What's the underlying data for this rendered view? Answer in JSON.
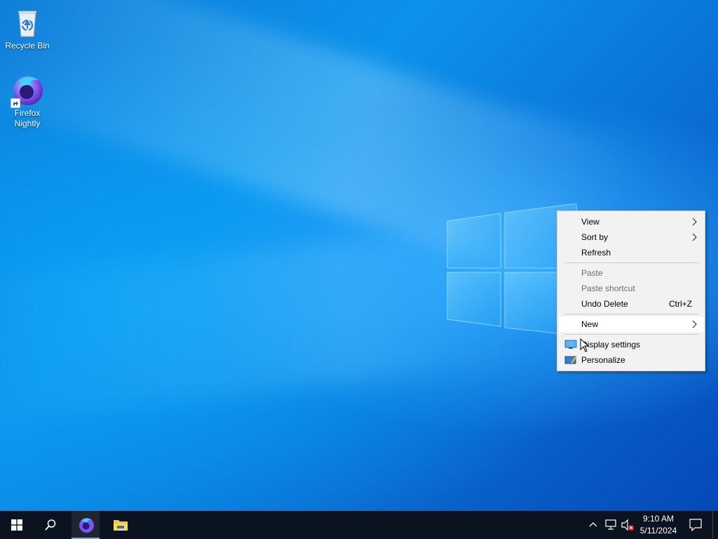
{
  "desktop": {
    "icons": [
      {
        "label": "Recycle Bin",
        "icon": "recycle-bin-icon"
      },
      {
        "label": "Firefox Nightly",
        "icon": "firefox-nightly-icon"
      }
    ]
  },
  "context_menu": {
    "items": [
      {
        "label": "View",
        "submenu": true,
        "enabled": true
      },
      {
        "label": "Sort by",
        "submenu": true,
        "enabled": true
      },
      {
        "label": "Refresh",
        "enabled": true
      },
      {
        "label": "Paste",
        "enabled": false
      },
      {
        "label": "Paste shortcut",
        "enabled": false
      },
      {
        "label": "Undo Delete",
        "shortcut": "Ctrl+Z",
        "enabled": true
      },
      {
        "label": "New",
        "submenu": true,
        "enabled": true,
        "highlighted": true
      },
      {
        "label": "Display settings",
        "icon": "display-settings-icon",
        "enabled": true
      },
      {
        "label": "Personalize",
        "icon": "personalize-icon",
        "enabled": true
      }
    ]
  },
  "taskbar": {
    "start_icon": "windows-start-icon",
    "search_icon": "search-icon",
    "pinned": [
      "firefox-nightly-icon",
      "file-explorer-icon"
    ],
    "tray_icons": [
      "chevron-up-icon",
      "network-icon",
      "volume-muted-icon"
    ],
    "clock": {
      "time": "9:10 AM",
      "date": "5/11/2024"
    },
    "notification_icon": "action-center-icon"
  },
  "colors": {
    "taskbar_bg": "#0b1320",
    "menu_bg": "#f2f2f2",
    "desktop_blue": "#0c92ec"
  }
}
